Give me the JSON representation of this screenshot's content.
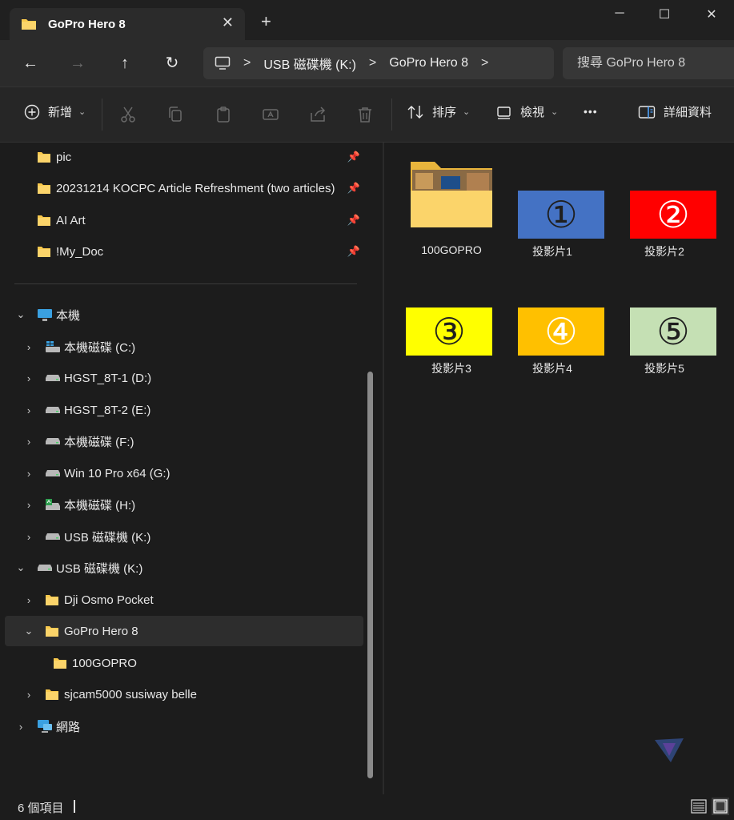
{
  "window": {
    "tab_title": "GoPro Hero 8",
    "new_tab": "+",
    "minimize": "─",
    "maximize": "☐",
    "close": "✕"
  },
  "nav": {
    "back": "←",
    "forward": "→",
    "up": "↑",
    "refresh": "↻",
    "breadcrumb": [
      "USB 磁碟機 (K:)",
      "GoPro Hero 8"
    ],
    "separator": ">",
    "search_placeholder": "搜尋 GoPro Hero 8"
  },
  "toolbar": {
    "new_label": "新增",
    "sort_label": "排序",
    "view_label": "檢視",
    "more_label": "•••",
    "details_label": "詳細資料"
  },
  "sidebar": {
    "quick_access": [
      {
        "label": "pic"
      },
      {
        "label": "20231214 KOCPC Article Refreshment (two articles)"
      },
      {
        "label": "AI Art"
      },
      {
        "label": "!My_Doc"
      }
    ],
    "this_pc": "本機",
    "drives": [
      {
        "label": "本機磁碟 (C:)"
      },
      {
        "label": "HGST_8T-1 (D:)"
      },
      {
        "label": "HGST_8T-2 (E:)"
      },
      {
        "label": "本機磁碟 (F:)"
      },
      {
        "label": "Win 10 Pro x64 (G:)"
      },
      {
        "label": "本機磁碟 (H:)"
      },
      {
        "label": "USB 磁碟機 (K:)"
      }
    ],
    "usb_root": "USB 磁碟機 (K:)",
    "usb_children": [
      {
        "label": "Dji Osmo Pocket"
      },
      {
        "label": "GoPro Hero 8"
      },
      {
        "label": "100GOPRO"
      },
      {
        "label": "sjcam5000 susiway belle"
      }
    ],
    "network": "網路"
  },
  "content": {
    "items": [
      {
        "name": "100GOPRO",
        "kind": "folder"
      },
      {
        "name": "投影片1",
        "glyph": "①",
        "bg": "#4472c4",
        "fg": "#1f1f1f"
      },
      {
        "name": "投影片2",
        "glyph": "②",
        "bg": "#ff0000",
        "fg": "#ffffff"
      },
      {
        "name": "投影片3",
        "glyph": "③",
        "bg": "#ffff00",
        "fg": "#1f1f1f"
      },
      {
        "name": "投影片4",
        "glyph": "④",
        "bg": "#ffc000",
        "fg": "#ffffff"
      },
      {
        "name": "投影片5",
        "glyph": "⑤",
        "bg": "#c5e0b4",
        "fg": "#1f1f1f"
      }
    ]
  },
  "status": {
    "item_count": "6 個項目"
  },
  "colors": {
    "folder_yellow": "#f8c84c",
    "accent_blue": "#4ea3ff"
  }
}
